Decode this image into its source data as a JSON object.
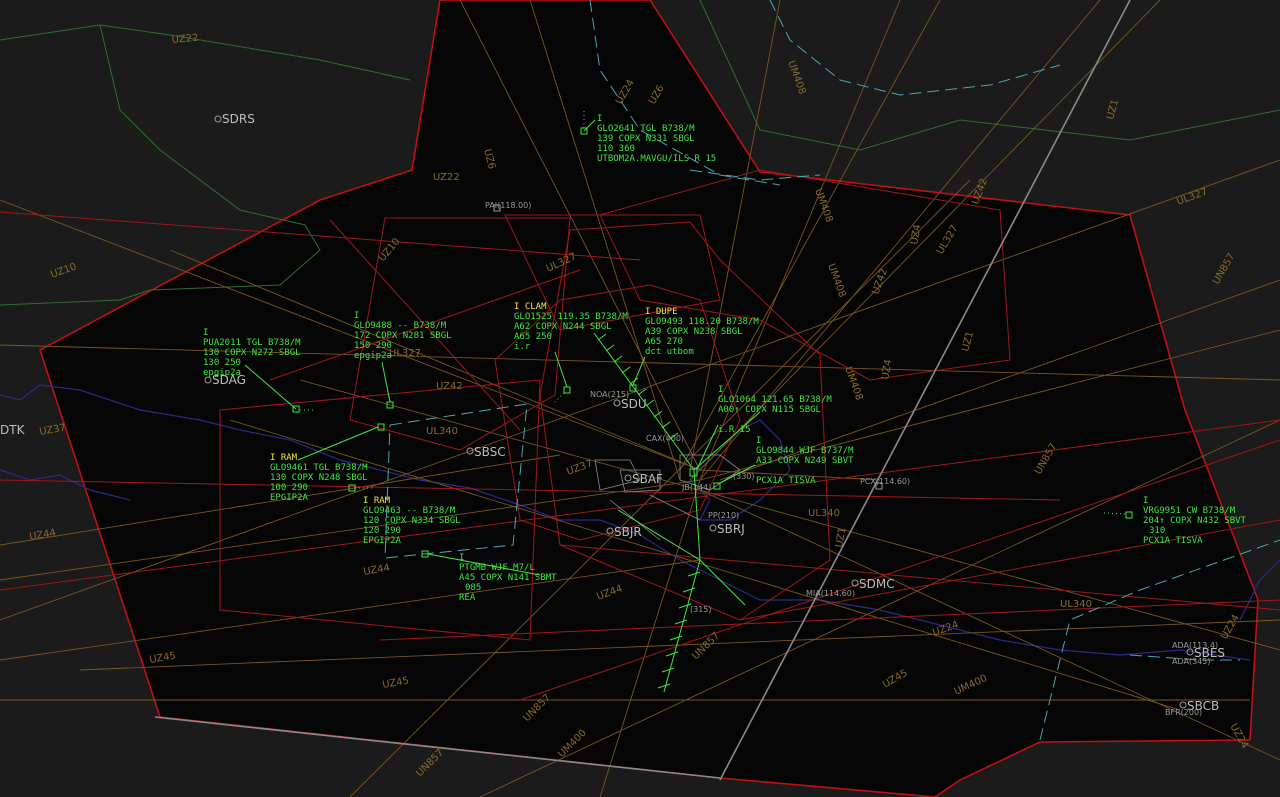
{
  "colors": {
    "background": "#1b1b1b",
    "sector_fill": "#050505",
    "sector_border": "#c01010",
    "airway": "#7a5520",
    "coast": "#2a2a8a",
    "green_line": "#2f6f2f",
    "track": "#3fe83f",
    "highlight": "#f2e83a",
    "dashed_cyan": "#4aa7b8",
    "label_gray": "#b0b0b0"
  },
  "airway_labels": [
    {
      "text": "UZ22"
    },
    {
      "text": "UZ6"
    },
    {
      "text": "UZ22"
    },
    {
      "text": "UZ10"
    },
    {
      "text": "UZ10"
    },
    {
      "text": "UL327"
    },
    {
      "text": "UZ42"
    },
    {
      "text": "UZ37"
    },
    {
      "text": "UZ37"
    },
    {
      "text": "UZ44"
    },
    {
      "text": "UZ44"
    },
    {
      "text": "UZ45"
    },
    {
      "text": "UZ45"
    },
    {
      "text": "UN857"
    },
    {
      "text": "UM400"
    },
    {
      "text": "UN857"
    },
    {
      "text": "UZ44"
    },
    {
      "text": "UZ45"
    },
    {
      "text": "UM400"
    },
    {
      "text": "UL340"
    },
    {
      "text": "UL340"
    },
    {
      "text": "UZ24"
    },
    {
      "text": "UL327"
    },
    {
      "text": "UN857"
    },
    {
      "text": "UM408"
    },
    {
      "text": "UM408"
    },
    {
      "text": "UM408"
    },
    {
      "text": "UZ42"
    },
    {
      "text": "UZ4"
    },
    {
      "text": "UZ1"
    },
    {
      "text": "UM408"
    },
    {
      "text": "UZ4"
    },
    {
      "text": "UZ42"
    },
    {
      "text": "UL327"
    },
    {
      "text": "UL327"
    },
    {
      "text": "UN857"
    },
    {
      "text": "UZ1"
    },
    {
      "text": "UN857"
    },
    {
      "text": "UZ24"
    },
    {
      "text": "UZ6"
    },
    {
      "text": "UZ24"
    },
    {
      "text": "UL340"
    },
    {
      "text": "UZ1"
    },
    {
      "text": "UZ24"
    }
  ],
  "airports": [
    {
      "name": "SDRS"
    },
    {
      "name": "SDAG"
    },
    {
      "name": "SBSC"
    },
    {
      "name": "SDMC"
    },
    {
      "name": "SBJR"
    },
    {
      "name": "SBRJ"
    },
    {
      "name": "SBES"
    },
    {
      "name": "SBCB"
    },
    {
      "name": "SDU"
    },
    {
      "name": "SBAF"
    }
  ],
  "fixes": [
    {
      "name": "PAI(118.00)"
    },
    {
      "name": "NOA(215)"
    },
    {
      "name": "CAX(400)"
    },
    {
      "name": "PCX(114.60)"
    },
    {
      "name": "MIA(114.60)"
    },
    {
      "name": "ADA(113.4)"
    },
    {
      "name": "ADA(345)"
    },
    {
      "name": "BFR(200)"
    },
    {
      "name": "(315)"
    },
    {
      "name": "JB(144)"
    },
    {
      "name": "(330)"
    },
    {
      "name": "PP(210)"
    }
  ],
  "left_labels": {
    "dtk": "DTK"
  },
  "tracks": [
    {
      "id": "GLO2641",
      "lines": [
        {
          "text": "I"
        },
        {
          "text": "GLO2641 TGL B738/M"
        },
        {
          "text": "139 COPX N331 SBGL"
        },
        {
          "text": "110 360"
        },
        {
          "text": "UTBOM2A.MAVGU/ILS R 15"
        }
      ]
    },
    {
      "id": "PUA2011",
      "lines": [
        {
          "text": "I"
        },
        {
          "text": "PUA2011 TGL B738/M"
        },
        {
          "text": "130 COPX N272 SBGL"
        },
        {
          "text": "130 250"
        },
        {
          "text": "epgip2a"
        }
      ]
    },
    {
      "id": "GLO9488",
      "lines": [
        {
          "text": "I"
        },
        {
          "text": "GLO9488 -- B738/M"
        },
        {
          "text": "172 COPX N281 SBGL"
        },
        {
          "text": "150 290"
        },
        {
          "text": "epgip2a"
        }
      ]
    },
    {
      "id": "GLO1525",
      "lines": [
        {
          "text": "I CLAM"
        },
        {
          "text": "GLO1525 119.35 B738/M"
        },
        {
          "text": "A62 COPX N244 SBGL"
        },
        {
          "text": "A65 250"
        },
        {
          "text": "i.r"
        }
      ]
    },
    {
      "id": "GLO9493",
      "lines": [
        {
          "text": "I DUPE"
        },
        {
          "text": "GLO9493 118.20 B738/M"
        },
        {
          "text": "A39 COPX N238 SBGL"
        },
        {
          "text": "A65 270"
        },
        {
          "text": "dct utbom"
        }
      ]
    },
    {
      "id": "GLO1064",
      "lines": [
        {
          "text": "I"
        },
        {
          "text": "GLO1064 121.65 B738/M"
        },
        {
          "text": "A00↑ COPX N115 SBGL"
        },
        {
          "text": "i.R 15"
        }
      ]
    },
    {
      "id": "GLO9844",
      "lines": [
        {
          "text": "I"
        },
        {
          "text": "GLO9844 WJF B737/M"
        },
        {
          "text": "A33 COPX N249 SBVT"
        },
        {
          "text": "PCX1A TISVA"
        }
      ]
    },
    {
      "id": "GLO9461",
      "lines": [
        {
          "text": "I RAM"
        },
        {
          "text": "GLO9461 TGL B738/M"
        },
        {
          "text": "130 COPX N248 SBGL"
        },
        {
          "text": "100 290"
        },
        {
          "text": "EPGIP2A"
        }
      ]
    },
    {
      "id": "GLO9463",
      "lines": [
        {
          "text": "I RAM"
        },
        {
          "text": "GLO9463 -- B738/M"
        },
        {
          "text": "120 COPX N334 SBGL"
        },
        {
          "text": "120 290"
        },
        {
          "text": "EPGIP2A"
        }
      ]
    },
    {
      "id": "PTGMB",
      "lines": [
        {
          "text": "I"
        },
        {
          "text": "PTGMB WJF M7/L"
        },
        {
          "text": "A45 COPX N141 SBMT"
        },
        {
          "text": "085"
        },
        {
          "text": "REA"
        }
      ]
    },
    {
      "id": "VRG9951",
      "lines": [
        {
          "text": "I"
        },
        {
          "text": "VRG9951 CW B738/M"
        },
        {
          "text": "204↑ COPX N432 SBVT"
        },
        {
          "text": "310"
        },
        {
          "text": "PCX1A TISVA"
        }
      ]
    }
  ]
}
